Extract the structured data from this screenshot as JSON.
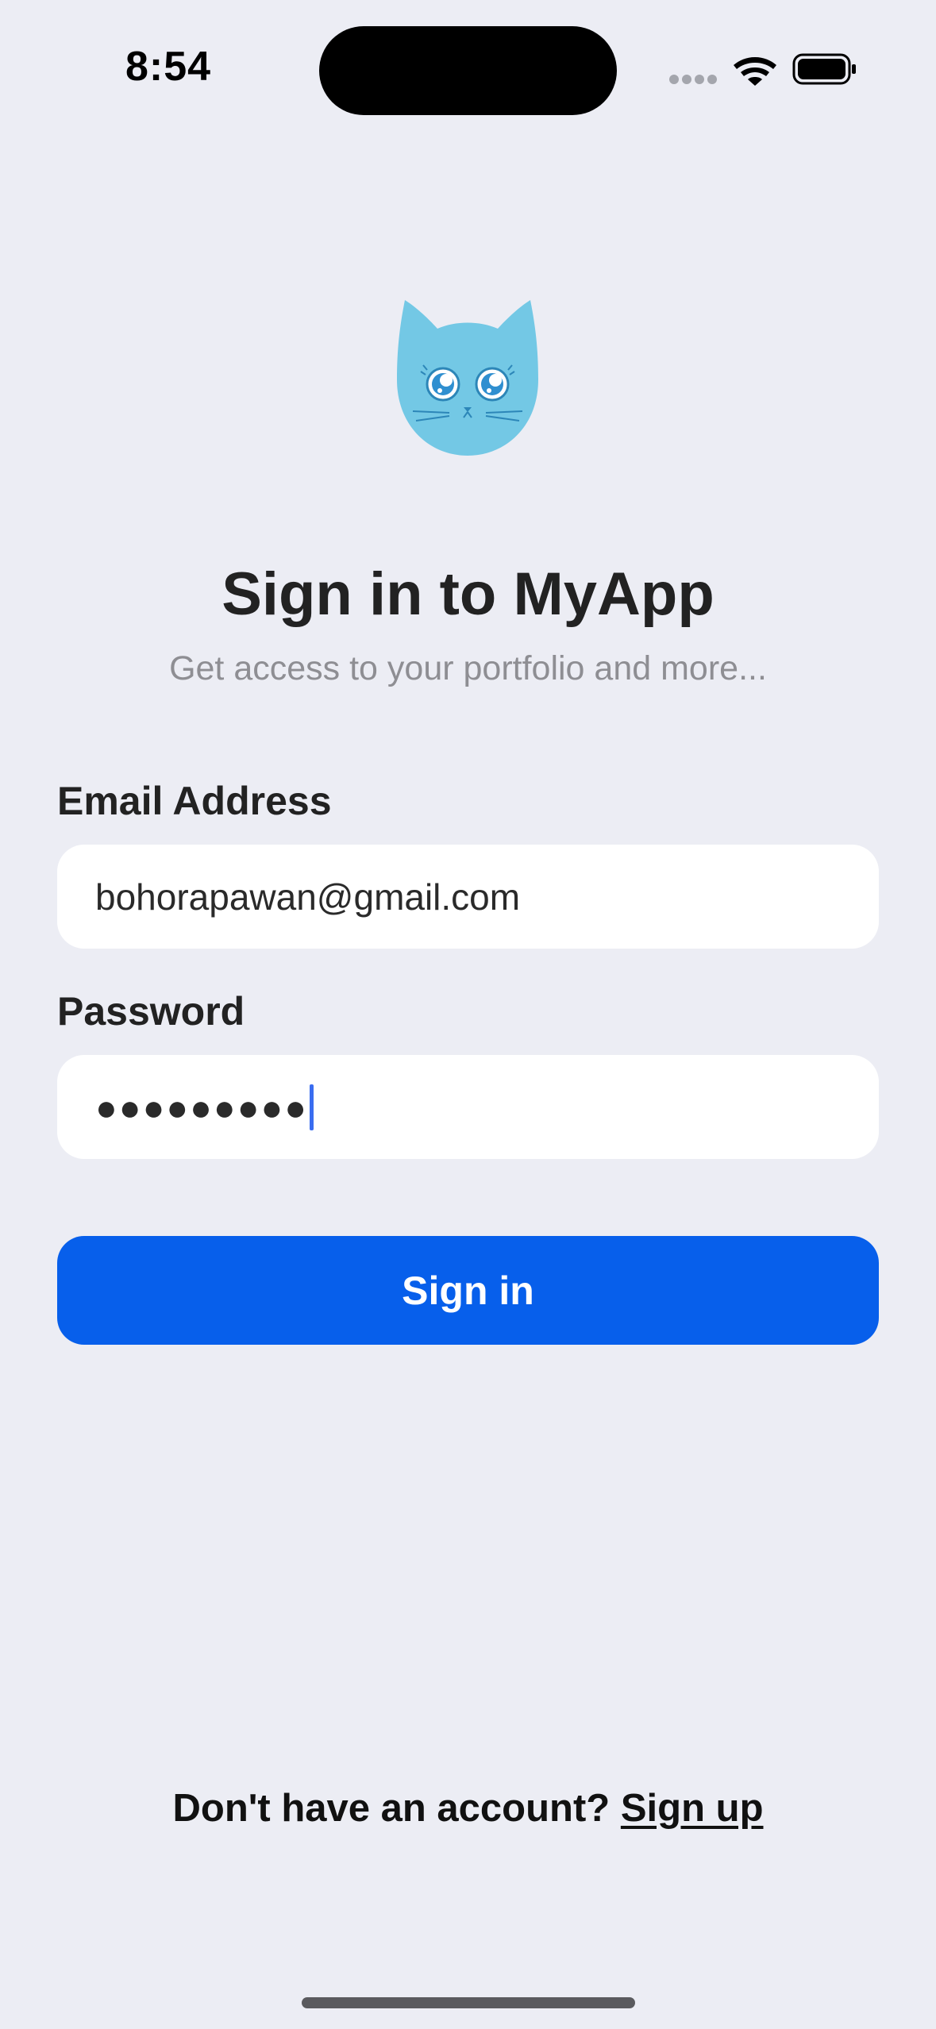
{
  "status_bar": {
    "time": "8:54"
  },
  "header": {
    "title": "Sign in to MyApp",
    "subtitle": "Get access to your portfolio and more..."
  },
  "form": {
    "email_label": "Email Address",
    "email_value": "bohorapawan@gmail.com",
    "password_label": "Password",
    "password_masked": "●●●●●●●●●",
    "submit_label": "Sign in"
  },
  "footer": {
    "prompt": "Don't have an account?",
    "link_label": "Sign up"
  },
  "colors": {
    "background": "#ECEDF4",
    "primary_button": "#075FEB",
    "logo_blue": "#73C8E5",
    "caret": "#3A6DF0"
  },
  "icons": {
    "logo": "cat-logo-icon",
    "wifi": "wifi-icon",
    "battery": "battery-icon",
    "signal": "signal-dots-icon"
  }
}
